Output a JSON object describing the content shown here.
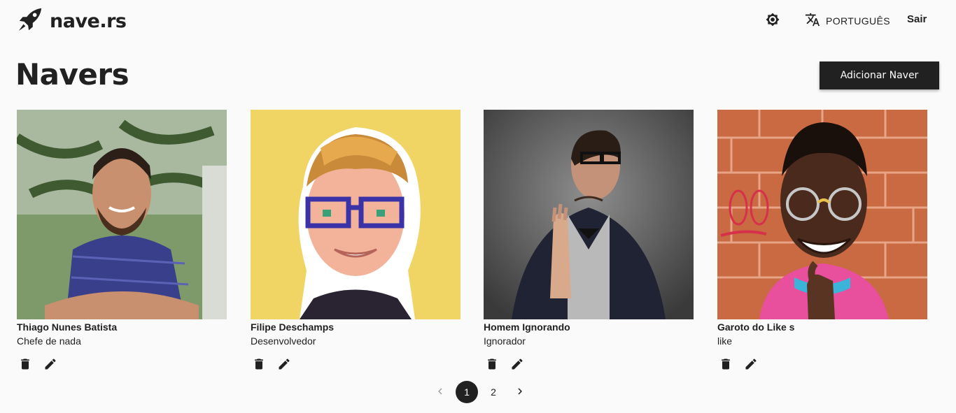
{
  "header": {
    "brand": "nave.rs",
    "language_label": "PORTUGUÊS",
    "logout_label": "Sair"
  },
  "main": {
    "title": "Navers",
    "add_button_label": "Adicionar Naver"
  },
  "navers": [
    {
      "name": "Thiago Nunes Batista",
      "role": "Chefe de nada"
    },
    {
      "name": "Filipe Deschamps",
      "role": "Desenvolvedor"
    },
    {
      "name": "Homem Ignorando",
      "role": "Ignorador"
    },
    {
      "name": "Garoto do Like s",
      "role": "like"
    }
  ],
  "pagination": {
    "pages": [
      "1",
      "2"
    ],
    "current": "1"
  },
  "icons": {
    "logo": "rocket-icon",
    "theme": "brightness-icon",
    "language": "translate-icon",
    "delete": "trash-icon",
    "edit": "pencil-icon",
    "prev": "chevron-left-icon",
    "next": "chevron-right-icon"
  },
  "colors": {
    "primary": "#212121",
    "background": "#fafafa"
  }
}
